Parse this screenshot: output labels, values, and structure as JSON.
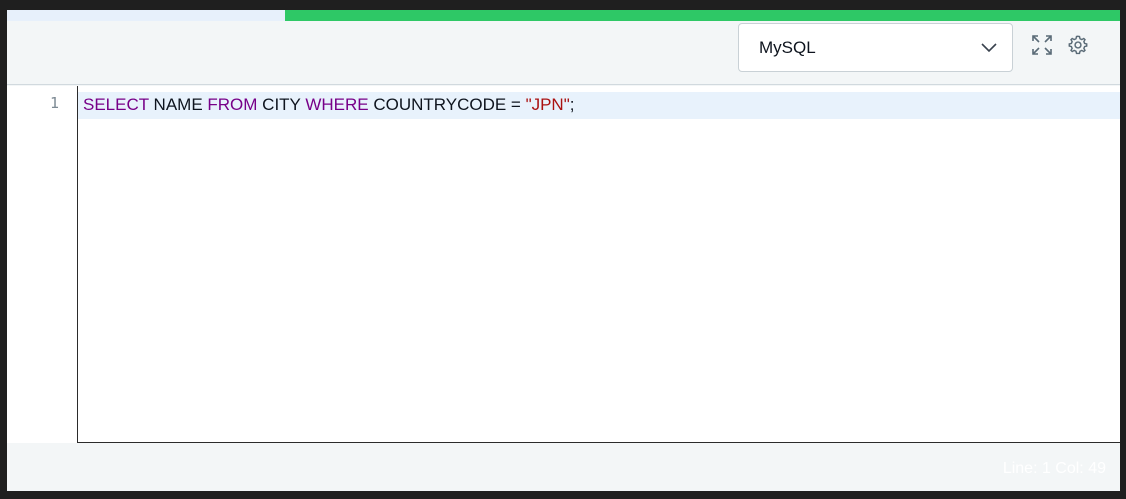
{
  "toolbar": {
    "language": "MySQL",
    "icons": {
      "dropdown": "chevron-down-icon",
      "expand": "expand-icon",
      "settings": "gear-icon"
    }
  },
  "editor": {
    "line_numbers": [
      "1"
    ],
    "code": {
      "t1": "SELECT",
      "t2": " NAME ",
      "t3": "FROM",
      "t4": " CITY ",
      "t5": "WHERE",
      "t6": " COUNTRYCODE = ",
      "t7": "\"JPN\"",
      "t8": ";"
    }
  },
  "status": {
    "cursor": "Line: 1 Col: 49"
  },
  "colors": {
    "accent_progress": "#2ec866",
    "keyword": "#770088",
    "string": "#aa1111",
    "active_line": "#e8f2fc"
  }
}
